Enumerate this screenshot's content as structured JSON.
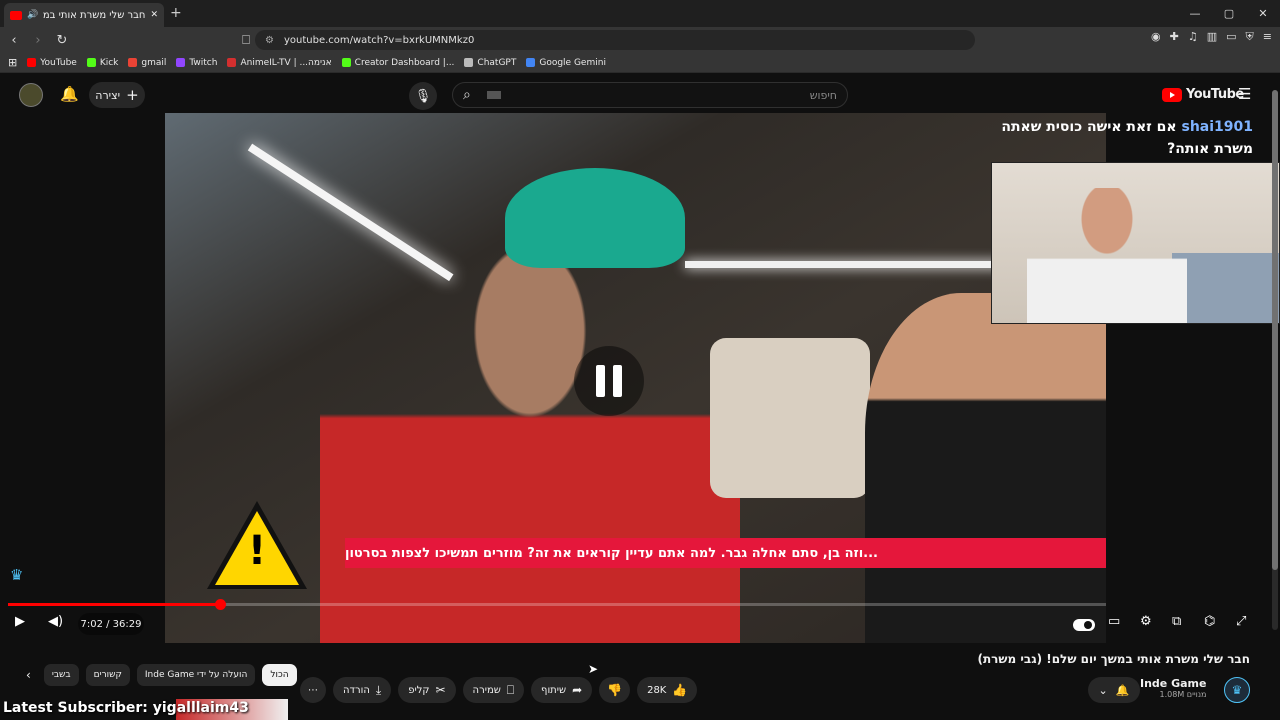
{
  "browser": {
    "tab_title": "חבר שלי משרת אותי במשך יו",
    "new_tab": "+",
    "window_controls": [
      "—",
      "▢",
      "✕"
    ],
    "url": "youtube.com/watch?v=bxrkUMNMkz0",
    "bookmarks": [
      {
        "label": "YouTube",
        "color": "#ff0000"
      },
      {
        "label": "Kick",
        "color": "#53fc18"
      },
      {
        "label": "gmail",
        "color": "#ea4335"
      },
      {
        "label": "Twitch",
        "color": "#9146ff"
      },
      {
        "label": "AnimeIL-TV | ...אנימה",
        "color": "#d32f2f"
      },
      {
        "label": "Creator Dashboard |...",
        "color": "#53fc18"
      },
      {
        "label": "ChatGPT",
        "color": "#bbbbbb"
      },
      {
        "label": "Google Gemini",
        "color": "#4285f4"
      }
    ]
  },
  "youtube_header": {
    "create_label": "יצירה",
    "search_placeholder": "חיפוש",
    "logo_text": "YouTube"
  },
  "video": {
    "subtitle": "...וזה בן, סתם אחלה גבר. למה אתם עדיין קוראים את זה? מוזרים תמשיכו לצפות בסרטון",
    "current_time": "7:02",
    "duration": "36:29",
    "time_display": "7:02 / 36:29",
    "progress_fraction": 0.193,
    "chat_user": "shai1901",
    "chat_message": "אם זאת אישה כוסית שאתה משרת אותה?"
  },
  "meta": {
    "title": "חבר שלי משרת אותי במשך יום שלם! (גבי משרת)",
    "likes": "28K",
    "share_label": "שיתוף",
    "save_label": "שמירה",
    "clip_label": "קליפ",
    "download_label": "הורדה",
    "channel_name": "Inde Game",
    "channel_subs": "1.08M מנויים",
    "chips": [
      "הכול",
      "Inde Game הועלה על ידי",
      "קשורים",
      "בשבי"
    ]
  },
  "overlay": {
    "latest_subscriber": "Latest Subscriber: yigalllaim43"
  },
  "colors": {
    "accent": "#ff0000",
    "subtitle_bg": "#e5173b",
    "chat_user": "#7fb3ff"
  }
}
